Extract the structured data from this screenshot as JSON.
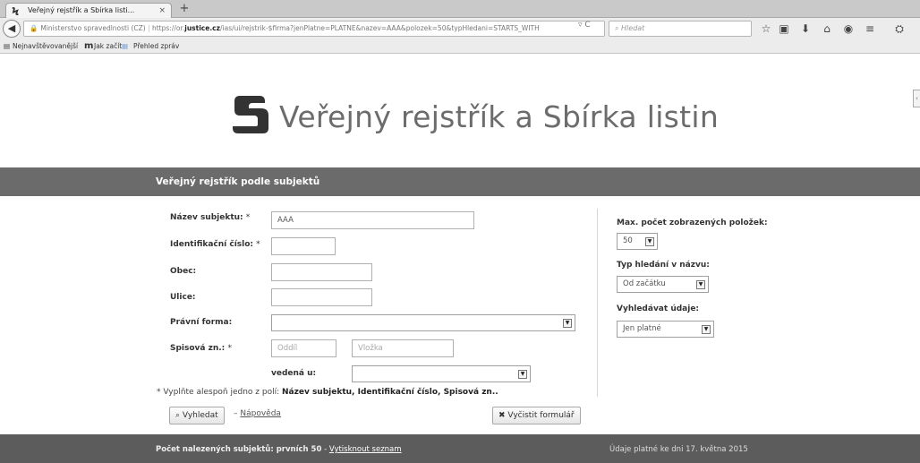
{
  "browser": {
    "tab_title": "Veřejný rejstřík a Sbírka listi...",
    "tab_close": "×",
    "new_tab": "+",
    "url_prefix": "Ministerstvo spravedlnosti (CZ)",
    "url_before_domain": "https://or.",
    "url_domain": "justice.cz",
    "url_after_domain": "/ias/ui/rejstrik-$firma?jenPlatne=PLATNE&nazev=AAA&polozek=50&typHledani=STARTS_WITH",
    "search_placeholder": "Hledat",
    "bookmarks": [
      "Nejnavštěvovanější",
      "Jak začít",
      "Přehled zpráv"
    ]
  },
  "page": {
    "logo_title": "Veřejný rejstřík a Sbírka listin",
    "section_title": "Veřejný rejstřík podle subjektů"
  },
  "form": {
    "nazev_label": "Název subjektu:",
    "nazev_value": "AAA",
    "ico_label": "Identifikační číslo:",
    "obec_label": "Obec:",
    "ulice_label": "Ulice:",
    "pravni_forma_label": "Právní forma:",
    "spisova_label": "Spisová zn.:",
    "oddil_placeholder": "Oddíl",
    "vlozka_placeholder": "Vložka",
    "vedena_label": "vedená u:",
    "required_mark": "*",
    "hint_prefix": "* Vyplňte alespoň jedno z polí: ",
    "hint_fields": "Název subjektu, Identifikační číslo, Spisová zn..",
    "search_button": "Vyhledat",
    "help_separator": "–",
    "help_link": "Nápověda",
    "clear_button": "Vyčistit formulář"
  },
  "options": {
    "max_label": "Max. počet zobrazených položek:",
    "max_value": "50",
    "typ_label": "Typ hledání v názvu:",
    "typ_value": "Od začátku",
    "vyhledavat_label": "Vyhledávat údaje:",
    "vyhledavat_value": "Jen platné"
  },
  "footer": {
    "found_label": "Počet nalezených subjektů: prvních 50",
    "separator": "-",
    "print_link": "Vytisknout seznam",
    "validity": "Údaje platné ke dni 17. května 2015"
  },
  "colors": {
    "header_bar": "#6b6b6b",
    "footer_bar": "#5c5c5c",
    "logo_text": "#6c6c6c"
  },
  "icons": [
    "star-icon",
    "bookmark-list-icon",
    "download-icon",
    "home-icon",
    "pocket-icon",
    "menu-icon",
    "reload-icon",
    "search-icon",
    "lock-icon",
    "back-icon",
    "clear-icon"
  ]
}
